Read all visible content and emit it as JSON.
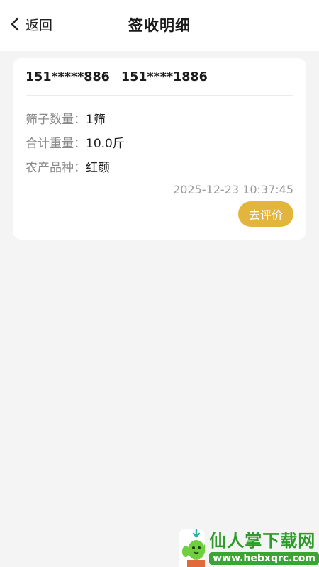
{
  "header": {
    "back_label": "返回",
    "title": "签收明细"
  },
  "card": {
    "phone_1": "151*****886",
    "phone_2": "151****1886",
    "rows": [
      {
        "key": "筛子数量：",
        "value": "1筛"
      },
      {
        "key": "合计重量：",
        "value": "10.0斤"
      },
      {
        "key": "农产品种：",
        "value": "红颜"
      }
    ],
    "timestamp": "2025-12-23 10:37:45",
    "action_label": "去评价"
  },
  "watermark": {
    "title": "仙人掌下载网",
    "url": "www.hebxqrc.com"
  },
  "colors": {
    "accent": "#e2b53c",
    "background": "#f4f4f4",
    "watermark_green": "#39a534"
  }
}
